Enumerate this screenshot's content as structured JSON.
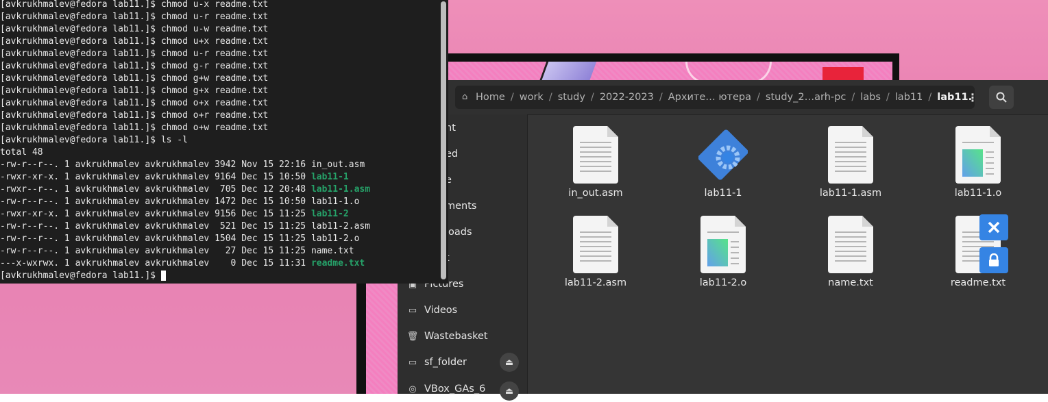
{
  "terminal": {
    "lines": [
      {
        "prompt": "[avkrukhmalev@fedora lab11.]$ ",
        "cmd": "chmod u-x readme.txt"
      },
      {
        "prompt": "[avkrukhmalev@fedora lab11.]$ ",
        "cmd": "chmod u-r readme.txt"
      },
      {
        "prompt": "[avkrukhmalev@fedora lab11.]$ ",
        "cmd": "chmod u-w readme.txt"
      },
      {
        "prompt": "[avkrukhmalev@fedora lab11.]$ ",
        "cmd": "chmod u+x readme.txt"
      },
      {
        "prompt": "[avkrukhmalev@fedora lab11.]$ ",
        "cmd": "chmod u-r readme.txt"
      },
      {
        "prompt": "[avkrukhmalev@fedora lab11.]$ ",
        "cmd": "chmod g-r readme.txt"
      },
      {
        "prompt": "[avkrukhmalev@fedora lab11.]$ ",
        "cmd": "chmod g+w readme.txt"
      },
      {
        "prompt": "[avkrukhmalev@fedora lab11.]$ ",
        "cmd": "chmod g+x readme.txt"
      },
      {
        "prompt": "[avkrukhmalev@fedora lab11.]$ ",
        "cmd": "chmod o+x readme.txt"
      },
      {
        "prompt": "[avkrukhmalev@fedora lab11.]$ ",
        "cmd": "chmod o+r readme.txt"
      },
      {
        "prompt": "[avkrukhmalev@fedora lab11.]$ ",
        "cmd": "chmod o+w readme.txt"
      },
      {
        "prompt": "[avkrukhmalev@fedora lab11.]$ ",
        "cmd": "ls -l"
      }
    ],
    "total": "total 48",
    "listing": [
      {
        "meta": "-rw-r--r--. 1 avkrukhmalev avkrukhmalev 3942 Nov 15 22:16 ",
        "name": "in_out.asm",
        "exec": false
      },
      {
        "meta": "-rwxr-xr-x. 1 avkrukhmalev avkrukhmalev 9164 Dec 15 10:50 ",
        "name": "lab11-1",
        "exec": true
      },
      {
        "meta": "-rwxr--r--. 1 avkrukhmalev avkrukhmalev  705 Dec 12 20:48 ",
        "name": "lab11-1.asm",
        "exec": true
      },
      {
        "meta": "-rw-r--r--. 1 avkrukhmalev avkrukhmalev 1472 Dec 15 10:50 ",
        "name": "lab11-1.o",
        "exec": false
      },
      {
        "meta": "-rwxr-xr-x. 1 avkrukhmalev avkrukhmalev 9156 Dec 15 11:25 ",
        "name": "lab11-2",
        "exec": true
      },
      {
        "meta": "-rw-r--r--. 1 avkrukhmalev avkrukhmalev  521 Dec 15 11:25 ",
        "name": "lab11-2.asm",
        "exec": false
      },
      {
        "meta": "-rw-r--r--. 1 avkrukhmalev avkrukhmalev 1504 Dec 15 11:25 ",
        "name": "lab11-2.o",
        "exec": false
      },
      {
        "meta": "-rw-r--r--. 1 avkrukhmalev avkrukhmalev   27 Dec 15 11:25 ",
        "name": "name.txt",
        "exec": false
      },
      {
        "meta": "---x-wxrwx. 1 avkrukhmalev avkrukhmalev    0 Dec 15 11:31 ",
        "name": "readme.txt",
        "exec": true
      }
    ],
    "final_prompt": "[avkrukhmalev@fedora lab11.]$ "
  },
  "files": {
    "path": [
      "Home",
      "work",
      "study",
      "2022-2023",
      "Архите… ютера",
      "study_2…arh-pc",
      "labs",
      "lab11",
      "lab11."
    ],
    "sidebar": [
      {
        "label": "nt",
        "icon": "recent-icon"
      },
      {
        "label": "ed",
        "icon": "starred-icon"
      },
      {
        "label": "e",
        "icon": "home-icon"
      },
      {
        "label": "ments",
        "icon": "documents-icon"
      },
      {
        "label": "loads",
        "icon": "downloads-icon"
      },
      {
        "label": "t",
        "icon": "music-icon"
      },
      {
        "label": "Pictures",
        "icon": "pictures-icon"
      },
      {
        "label": "Videos",
        "icon": "videos-icon"
      },
      {
        "label": "Wastebasket",
        "icon": "wastebasket-icon"
      },
      {
        "label": "sf_folder",
        "icon": "drive-icon"
      },
      {
        "label": "VBox_GAs_6",
        "icon": "disc-icon"
      }
    ],
    "items": [
      {
        "name": "in_out.asm",
        "kind": "text"
      },
      {
        "name": "lab11-1",
        "kind": "executable"
      },
      {
        "name": "lab11-1.asm",
        "kind": "text"
      },
      {
        "name": "lab11-1.o",
        "kind": "object"
      },
      {
        "name": "lab11-2.asm",
        "kind": "text"
      },
      {
        "name": "lab11-2.o",
        "kind": "object"
      },
      {
        "name": "name.txt",
        "kind": "text"
      },
      {
        "name": "readme.txt",
        "kind": "text-locked"
      }
    ]
  },
  "colors": {
    "exec_green": "#26a269",
    "emblem_blue": "#3584e4",
    "terminal_bg": "#1e1e1e",
    "files_bg": "#353535"
  }
}
